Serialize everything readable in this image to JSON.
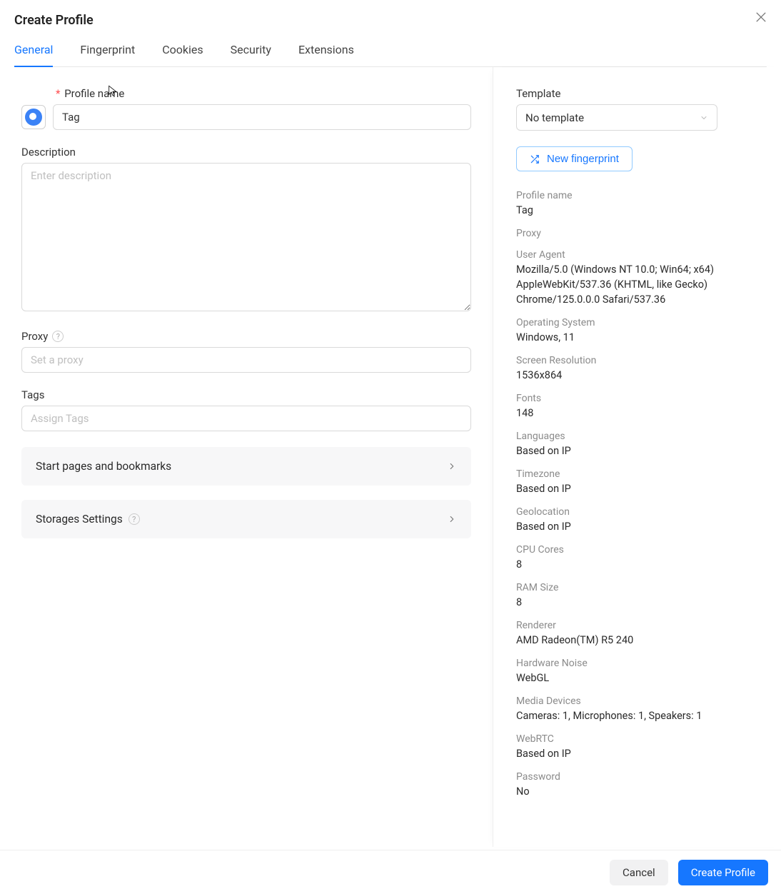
{
  "title": "Create Profile",
  "tabs": [
    "General",
    "Fingerprint",
    "Cookies",
    "Security",
    "Extensions"
  ],
  "active_tab": 0,
  "left": {
    "profile_name_label": "Profile name",
    "profile_name_value": "Tag",
    "description_label": "Description",
    "description_placeholder": "Enter description",
    "proxy_label": "Proxy",
    "proxy_placeholder": "Set a proxy",
    "tags_label": "Tags",
    "tags_placeholder": "Assign Tags",
    "panel_start": "Start pages and bookmarks",
    "panel_storage": "Storages Settings"
  },
  "right": {
    "template_label": "Template",
    "template_value": "No template",
    "new_fp_label": "New fingerprint",
    "info": [
      {
        "k": "Profile name",
        "v": "Tag"
      },
      {
        "k": "Proxy",
        "v": ""
      },
      {
        "k": "User Agent",
        "v": "Mozilla/5.0 (Windows NT 10.0; Win64; x64) AppleWebKit/537.36 (KHTML, like Gecko) Chrome/125.0.0.0 Safari/537.36"
      },
      {
        "k": "Operating System",
        "v": "Windows, 11"
      },
      {
        "k": "Screen Resolution",
        "v": "1536x864"
      },
      {
        "k": "Fonts",
        "v": "148"
      },
      {
        "k": "Languages",
        "v": "Based on IP"
      },
      {
        "k": "Timezone",
        "v": "Based on IP"
      },
      {
        "k": "Geolocation",
        "v": "Based on IP"
      },
      {
        "k": "CPU Cores",
        "v": "8"
      },
      {
        "k": "RAM Size",
        "v": "8"
      },
      {
        "k": "Renderer",
        "v": "AMD Radeon(TM) R5 240"
      },
      {
        "k": "Hardware Noise",
        "v": "WebGL"
      },
      {
        "k": "Media Devices",
        "v": "Cameras: 1, Microphones: 1, Speakers: 1"
      },
      {
        "k": "WebRTC",
        "v": "Based on IP"
      },
      {
        "k": "Password",
        "v": "No"
      }
    ]
  },
  "footer": {
    "cancel": "Cancel",
    "create": "Create Profile"
  }
}
